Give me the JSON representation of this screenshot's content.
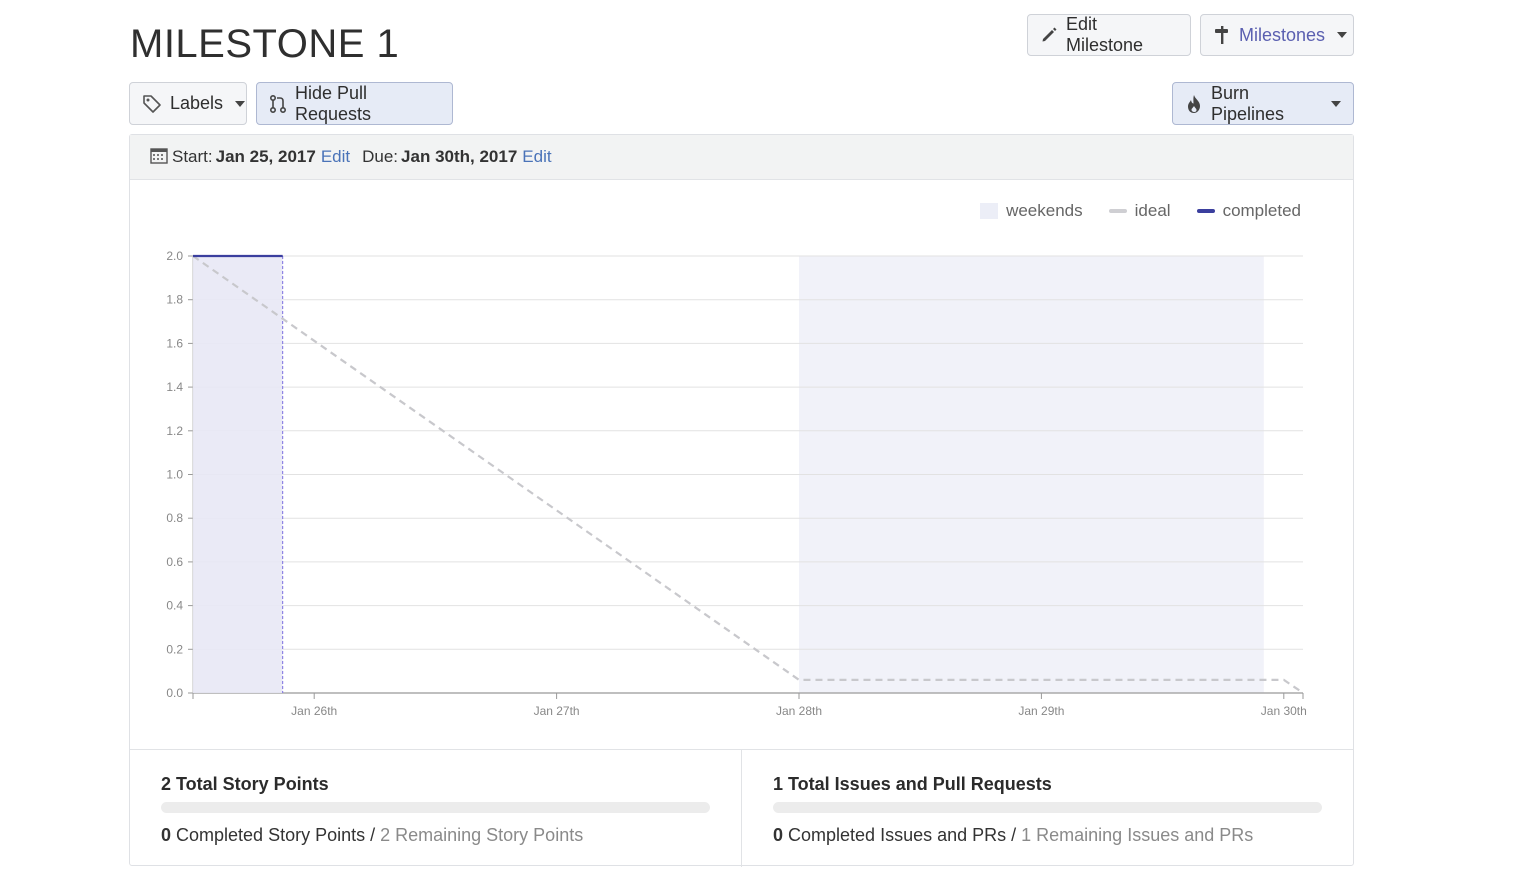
{
  "title": "MILESTONE 1",
  "toolbar": {
    "edit_milestone": "Edit Milestone",
    "milestones": "Milestones",
    "labels": "Labels",
    "hide_pull_requests": "Hide Pull Requests",
    "burn_pipelines": "Burn Pipelines"
  },
  "dates": {
    "start_label": "Start:",
    "start_value": "Jan 25, 2017",
    "start_edit": "Edit",
    "due_label": "Due:",
    "due_value": "Jan 30th, 2017",
    "due_edit": "Edit"
  },
  "legend": {
    "weekends": "weekends",
    "ideal": "ideal",
    "completed": "completed"
  },
  "colors": {
    "accent": "#5a5fb0",
    "completed_line": "#3b3f9e",
    "ideal_line": "#c8c8cc",
    "weekend_band": "#eceef7",
    "link": "#4a73b8"
  },
  "icons": {
    "edit": "pencil-icon",
    "milestones": "signpost-icon",
    "labels": "tag-icon",
    "pull_requests": "pull-request-icon",
    "burn": "flame-icon",
    "calendar": "calendar-icon"
  },
  "chart_data": {
    "type": "line",
    "ylim": [
      0,
      2
    ],
    "yticks": [
      "0.0",
      "0.2",
      "0.4",
      "0.6",
      "0.8",
      "1.0",
      "1.2",
      "1.4",
      "1.6",
      "1.8",
      "2.0"
    ],
    "xticks": [
      "Jan 26th",
      "Jan 27th",
      "Jan 28th",
      "Jan 29th",
      "Jan 30th"
    ],
    "weekend_range": [
      "Jan 28th",
      "Jan 30th"
    ],
    "series": [
      {
        "name": "ideal",
        "style": "dashed",
        "points": [
          [
            "Jan 25",
            2.0
          ],
          [
            "Jan 28",
            0.06
          ],
          [
            "Jan 30",
            0.06
          ],
          [
            "Jan 30 end",
            0.0
          ]
        ]
      },
      {
        "name": "completed",
        "style": "solid",
        "points": [
          [
            "Jan 25",
            2.0
          ],
          [
            "Jan 25 end",
            2.0
          ]
        ]
      }
    ],
    "grid": true,
    "legend_position": "top-right"
  },
  "stats": {
    "story_points": {
      "title": "2 Total Story Points",
      "completed_count": "0",
      "completed_label": " Completed Story Points / ",
      "remaining": "2 Remaining Story Points",
      "progress": 0
    },
    "issues": {
      "title": "1 Total Issues and Pull Requests",
      "completed_count": "0",
      "completed_label": " Completed Issues and PRs / ",
      "remaining": "1 Remaining Issues and PRs",
      "progress": 0
    }
  }
}
